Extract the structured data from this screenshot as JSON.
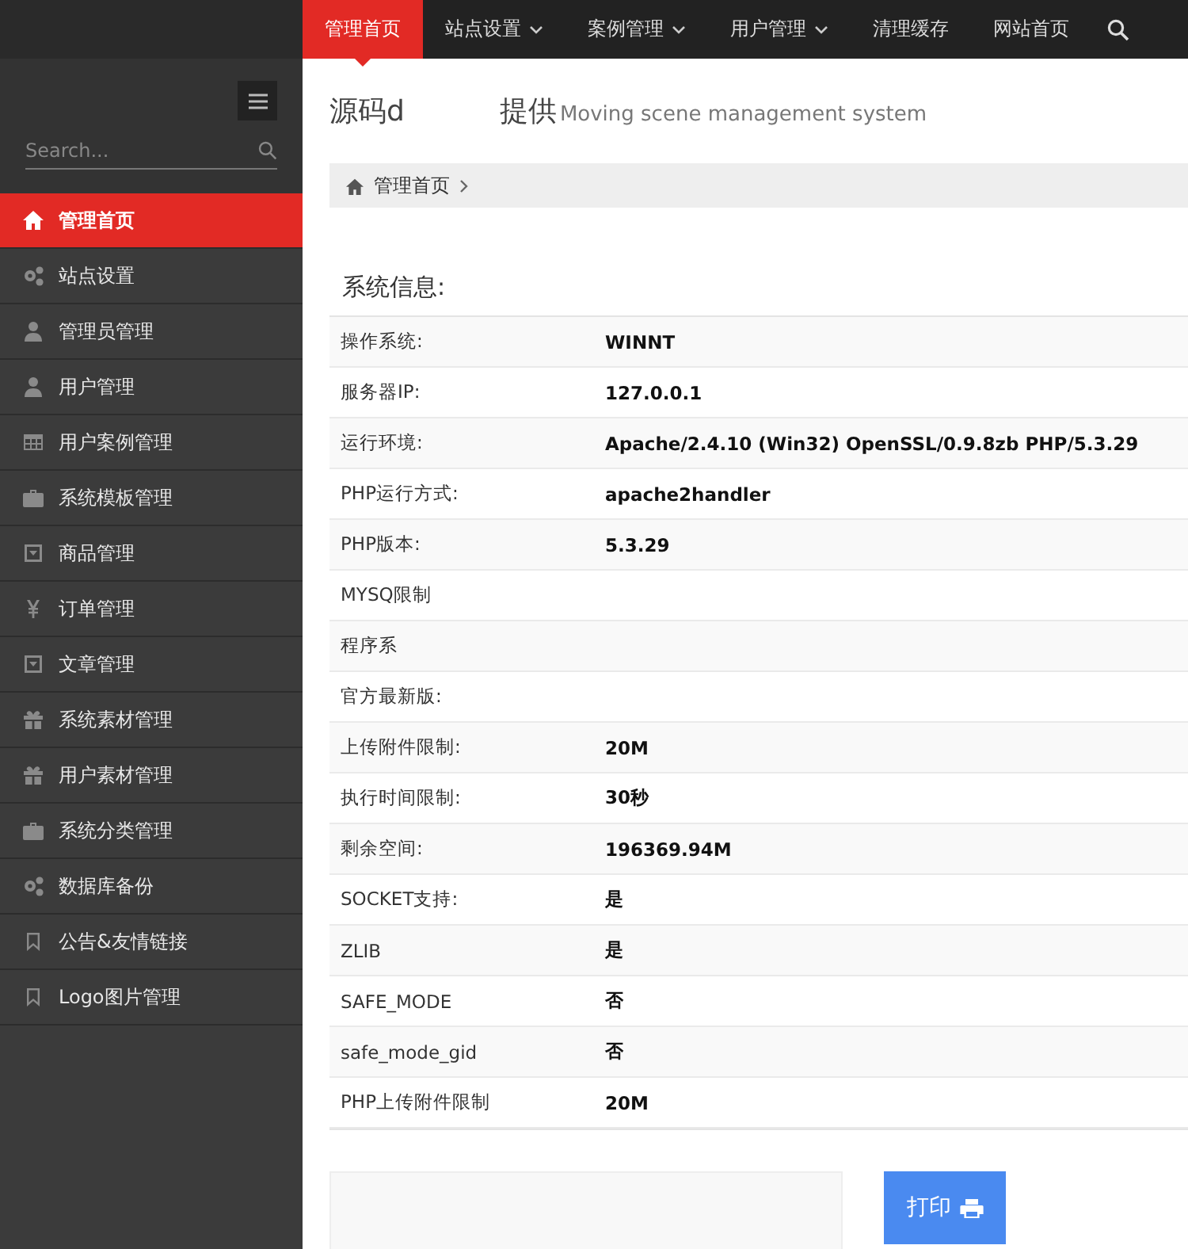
{
  "top_nav": [
    {
      "label": "管理首页",
      "selected": true,
      "dropdown": false
    },
    {
      "label": "站点设置",
      "selected": false,
      "dropdown": true
    },
    {
      "label": "案例管理",
      "selected": false,
      "dropdown": true
    },
    {
      "label": "用户管理",
      "selected": false,
      "dropdown": true
    },
    {
      "label": "清理缓存",
      "selected": false,
      "dropdown": false
    },
    {
      "label": "网站首页",
      "selected": false,
      "dropdown": false
    }
  ],
  "sidebar": {
    "search": {
      "placeholder": "Search..."
    },
    "items": [
      {
        "label": "管理首页",
        "selected": true
      },
      {
        "label": "站点设置",
        "selected": false
      },
      {
        "label": "管理员管理",
        "selected": false
      },
      {
        "label": "用户管理",
        "selected": false
      },
      {
        "label": "用户案例管理",
        "selected": false
      },
      {
        "label": "系统模板管理",
        "selected": false
      },
      {
        "label": "商品管理",
        "selected": false
      },
      {
        "label": "订单管理",
        "selected": false
      },
      {
        "label": "文章管理",
        "selected": false
      },
      {
        "label": "系统素材管理",
        "selected": false
      },
      {
        "label": "用户素材管理",
        "selected": false
      },
      {
        "label": "系统分类管理",
        "selected": false
      },
      {
        "label": "数据库备份",
        "selected": false
      },
      {
        "label": "公告&友情链接",
        "selected": false
      },
      {
        "label": "Logo图片管理",
        "selected": false
      }
    ]
  },
  "header": {
    "title_parts": [
      "源码d",
      "提供"
    ],
    "subtitle": "Moving scene management system"
  },
  "breadcrumb": [
    "管理首页"
  ],
  "section_title": "系统信息:",
  "info_rows": [
    {
      "label": "操作系统:",
      "value": "WINNT"
    },
    {
      "label": "服务器IP:",
      "value": "127.0.0.1"
    },
    {
      "label": "运行环境:",
      "value": "Apache/2.4.10 (Win32) OpenSSL/0.9.8zb PHP/5.3.29"
    },
    {
      "label": "PHP运行方式:",
      "value": "apache2handler"
    },
    {
      "label": "PHP版本:",
      "value": "5.3.29"
    },
    {
      "label": "MYSQ限制"
    },
    {
      "label": "程序系"
    },
    {
      "label": "官方最新版:"
    },
    {
      "label": "上传附件限制:",
      "value": "20M"
    },
    {
      "label": "执行时间限制:",
      "value": "30秒"
    },
    {
      "label": "剩余空间:",
      "value": "196369.94M"
    },
    {
      "label": "SOCKET支持:",
      "value": "是"
    },
    {
      "label": "ZLIB",
      "value": "是"
    },
    {
      "label": "SAFE_MODE",
      "value": "否"
    },
    {
      "label": "safe_mode_gid",
      "value": "否"
    },
    {
      "label": "PHP上传附件限制",
      "value": "20M"
    }
  ],
  "print_button": {
    "label": "打印"
  }
}
